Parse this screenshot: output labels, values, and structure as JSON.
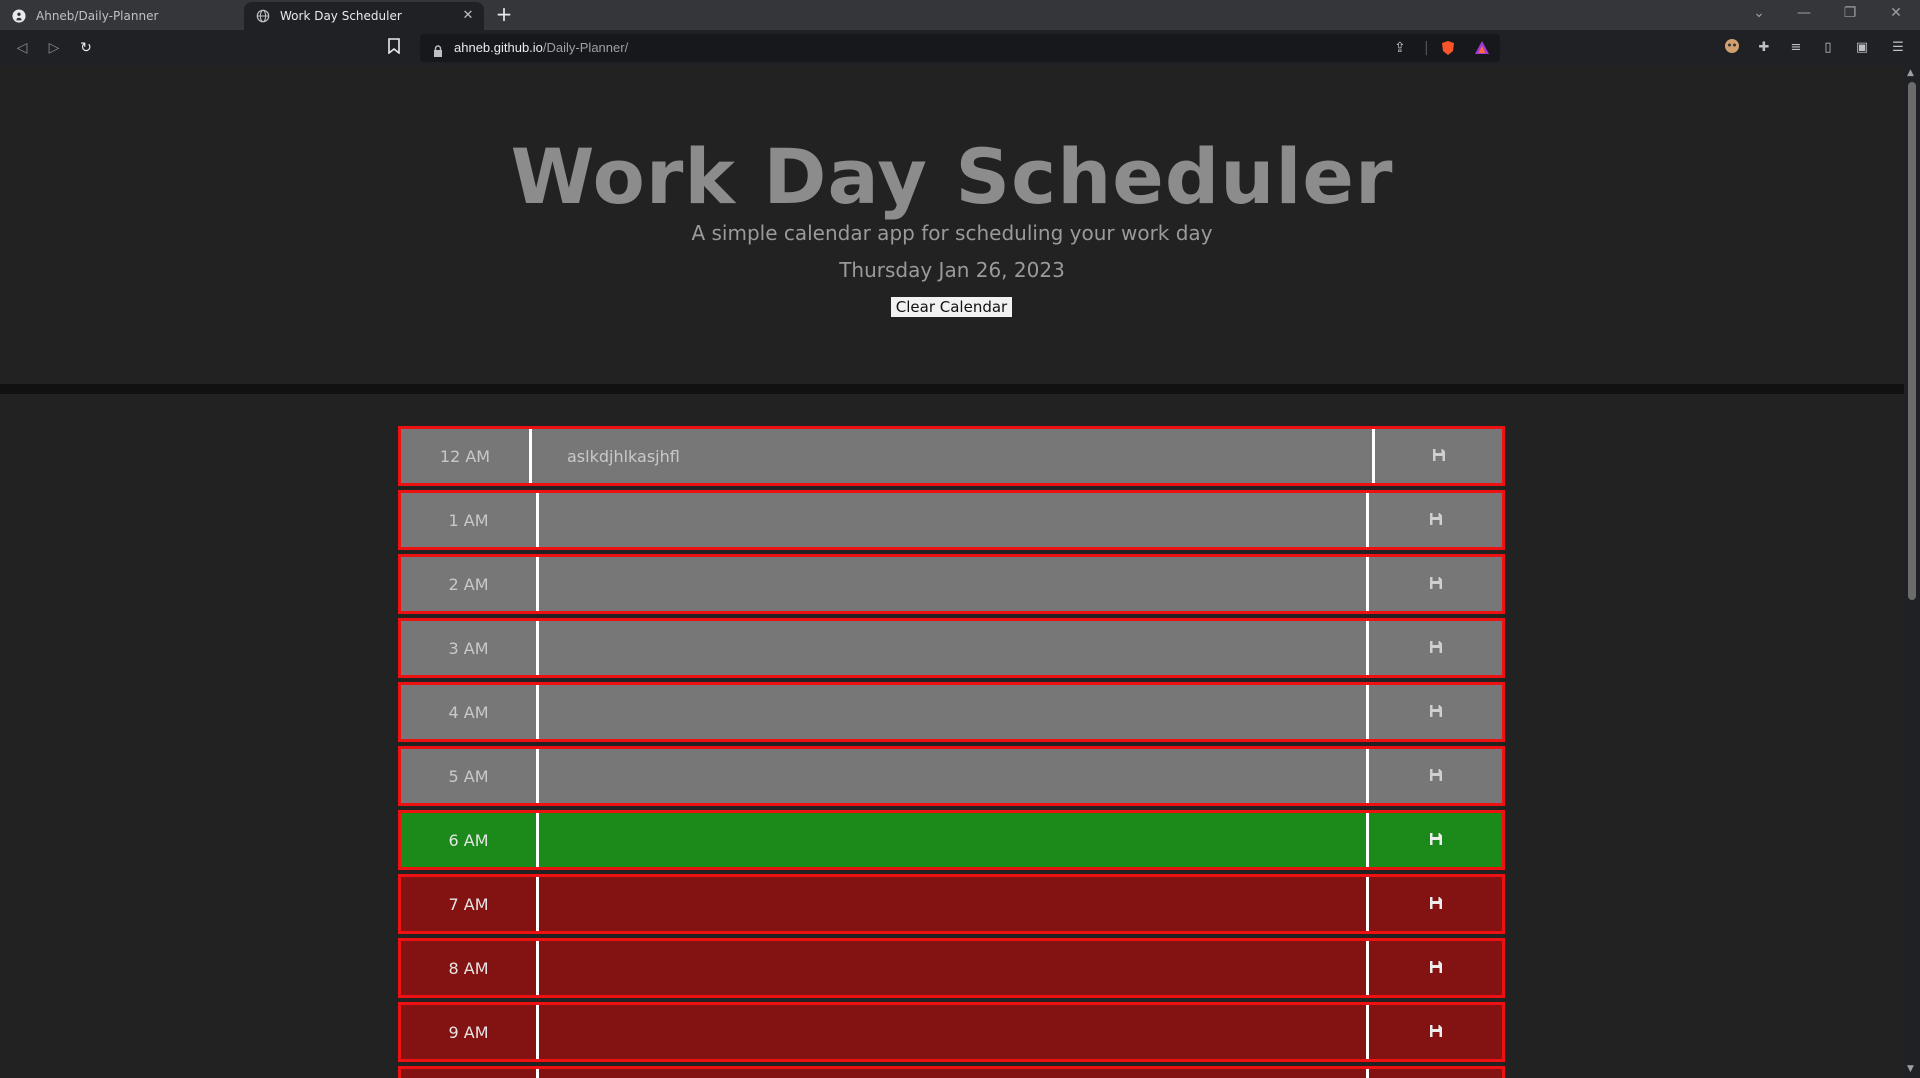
{
  "browser": {
    "tabs": [
      {
        "title": "Ahneb/Daily-Planner",
        "favicon": "github-icon",
        "active": false
      },
      {
        "title": "Work Day Scheduler",
        "favicon": "globe-icon",
        "active": true
      }
    ],
    "url_host": "ahneb.github.io",
    "url_path": "/Daily-Planner/"
  },
  "header": {
    "title": "Work Day Scheduler",
    "lead": "A simple calendar app for scheduling your work day",
    "current_day": "Thursday Jan 26, 2023",
    "clear_button": "Clear Calendar"
  },
  "colors": {
    "past": "#777777",
    "present": "#1b8a1b",
    "future": "#831313",
    "row_border": "#ee1111"
  },
  "timeblocks": [
    {
      "hour": "12 AM",
      "text": "aslkdjhlkasjhfl",
      "state": "past"
    },
    {
      "hour": "1 AM",
      "text": "",
      "state": "past"
    },
    {
      "hour": "2 AM",
      "text": "",
      "state": "past"
    },
    {
      "hour": "3 AM",
      "text": "",
      "state": "past"
    },
    {
      "hour": "4 AM",
      "text": "",
      "state": "past"
    },
    {
      "hour": "5 AM",
      "text": "",
      "state": "past"
    },
    {
      "hour": "6 AM",
      "text": "",
      "state": "present"
    },
    {
      "hour": "7 AM",
      "text": "",
      "state": "future"
    },
    {
      "hour": "8 AM",
      "text": "",
      "state": "future"
    },
    {
      "hour": "9 AM",
      "text": "",
      "state": "future"
    },
    {
      "hour": "",
      "text": "",
      "state": "future"
    }
  ]
}
